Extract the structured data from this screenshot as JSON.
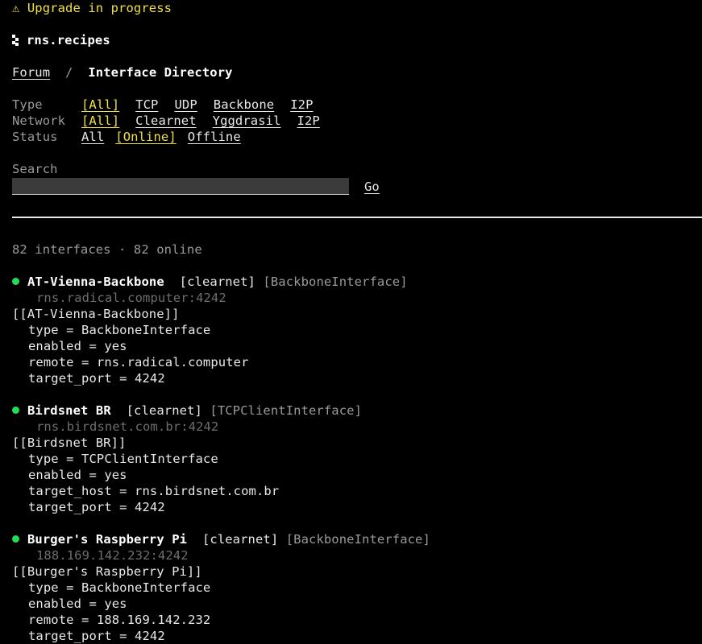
{
  "banner": {
    "icon": "⚠",
    "text": "Upgrade in progress"
  },
  "site": {
    "name": "rns.recipes",
    "logo_icon": "pixel-logo-icon"
  },
  "breadcrumb": {
    "parent": "Forum",
    "separator": "/",
    "current": "Interface Directory"
  },
  "filters": {
    "type": {
      "label": "Type",
      "options": [
        "[All]",
        "TCP",
        "UDP",
        "Backbone",
        "I2P"
      ],
      "selected": 0
    },
    "network": {
      "label": "Network",
      "options": [
        "[All]",
        "Clearnet",
        "Yggdrasil",
        "I2P"
      ],
      "selected": 0
    },
    "status": {
      "label": "Status",
      "options": [
        "All",
        "[Online]",
        "Offline"
      ],
      "selected": 1
    }
  },
  "search": {
    "label": "Search",
    "value": "",
    "go_label": "Go"
  },
  "summary": "82 interfaces · 82 online",
  "colors": {
    "accent": "#f0e040",
    "online": "#22dd55",
    "background": "#000000",
    "text": "#e8e8e8"
  },
  "interfaces": [
    {
      "name": "AT-Vienna-Backbone",
      "network_tag": "[clearnet]",
      "type_tag": "[BackboneInterface]",
      "address": "rns.radical.computer:4242",
      "config_header": "[[AT-Vienna-Backbone]]",
      "config": [
        "type = BackboneInterface",
        "enabled = yes",
        "remote = rns.radical.computer",
        "target_port = 4242"
      ]
    },
    {
      "name": "Birdsnet BR",
      "network_tag": "[clearnet]",
      "type_tag": "[TCPClientInterface]",
      "address": "rns.birdsnet.com.br:4242",
      "config_header": "[[Birdsnet BR]]",
      "config": [
        "type = TCPClientInterface",
        "enabled = yes",
        "target_host = rns.birdsnet.com.br",
        "target_port = 4242"
      ]
    },
    {
      "name": "Burger's Raspberry Pi",
      "network_tag": "[clearnet]",
      "type_tag": "[BackboneInterface]",
      "address": "188.169.142.232:4242",
      "config_header": "[[Burger's Raspberry Pi]]",
      "config": [
        "type = BackboneInterface",
        "enabled = yes",
        "remote = 188.169.142.232",
        "target_port = 4242"
      ]
    }
  ]
}
